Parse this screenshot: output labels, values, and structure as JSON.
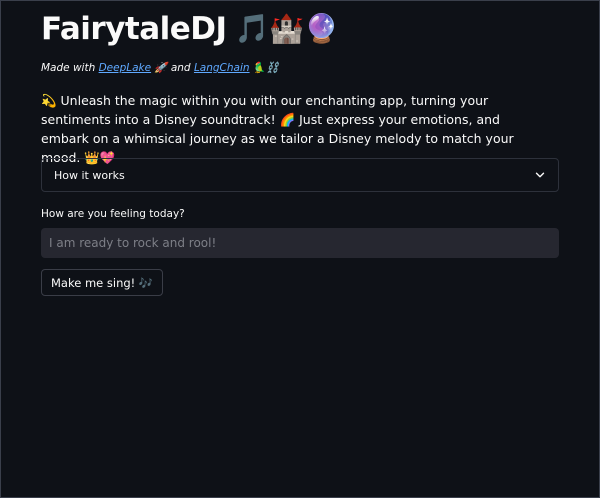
{
  "header": {
    "title": "FairytaleDJ",
    "title_emojis": "🎵🏰🔮"
  },
  "subtitle": {
    "prefix": "Made with",
    "link1": "DeepLake",
    "emoji1": "🚀",
    "connector": "and",
    "link2": "LangChain",
    "emoji2": "🦜⛓️"
  },
  "intro": {
    "text": "💫 Unleash the magic within you with our enchanting app, turning your sentiments into a Disney soundtrack! 🌈 Just express your emotions, and embark on a whimsical journey as we tailor a Disney melody to match your mood. 👑💖"
  },
  "expander": {
    "label": "How it works"
  },
  "mood_input": {
    "label": "How are you feeling today?",
    "value": "",
    "placeholder": "I am ready to rock and rool!"
  },
  "action_button": {
    "label": "Make me sing! 🎶"
  }
}
